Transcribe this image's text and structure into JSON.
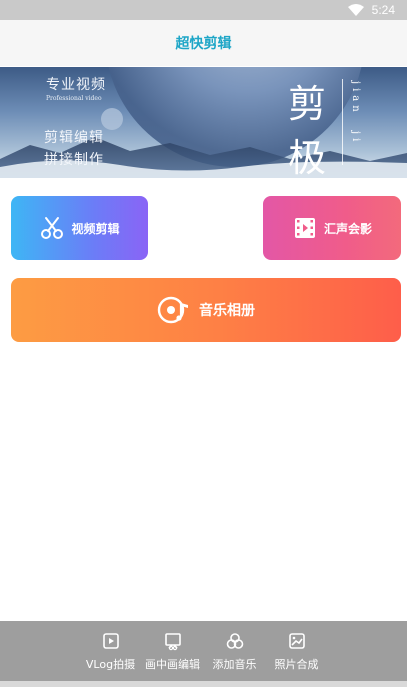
{
  "status_bar": {
    "time": "5:24"
  },
  "header": {
    "title": "超快剪辑"
  },
  "banner": {
    "line1": "专业视频",
    "line1_sub": "Professional video",
    "line2": "剪辑编辑",
    "line3": "拼接制作",
    "big_char_1": "剪",
    "big_char_2": "极",
    "pinyin_1": "jian",
    "pinyin_2": "ji"
  },
  "buttons": {
    "video_edit": {
      "label": "视频剪辑",
      "icon": "scissors-icon"
    },
    "voice_mix": {
      "label": "汇声会影",
      "icon": "film-icon"
    },
    "music_album": {
      "label": "音乐相册",
      "icon": "music-disc-icon"
    }
  },
  "bottom_nav": {
    "items": [
      {
        "label": "VLog拍摄",
        "icon": "play-square-icon"
      },
      {
        "label": "画中画编辑",
        "icon": "picture-in-picture-icon"
      },
      {
        "label": "添加音乐",
        "icon": "circles-icon"
      },
      {
        "label": "照片合成",
        "icon": "image-icon"
      }
    ]
  },
  "colors": {
    "title": "#1ea6c7",
    "video_btn_start": "#3eb6f5",
    "video_btn_end": "#8a64f6",
    "mix_btn_start": "#e357a6",
    "mix_btn_end": "#f36a7c",
    "music_btn_start": "#fd9c43",
    "music_btn_end": "#fe5e4a",
    "nav_bg": "#9e9e9e"
  }
}
